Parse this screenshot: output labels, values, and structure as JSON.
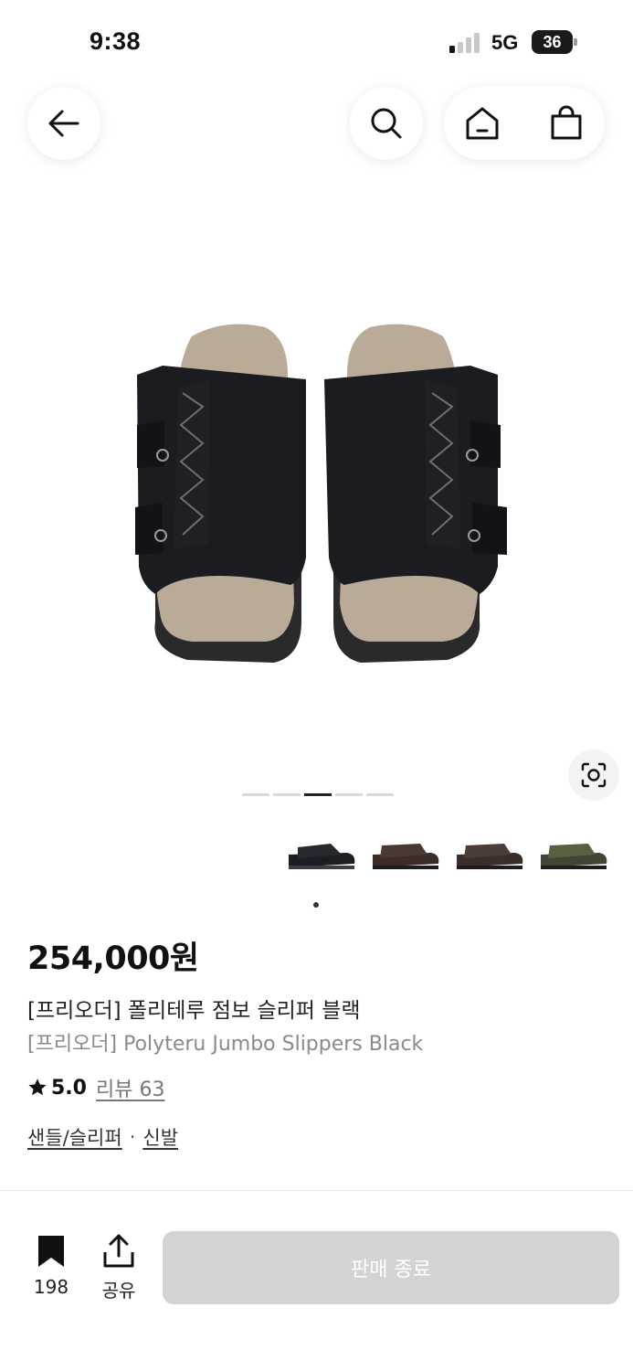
{
  "status_bar": {
    "time": "9:38",
    "network": "5G",
    "battery": "36"
  },
  "nav": {
    "back_icon": "arrow-left-icon",
    "search_icon": "search-icon",
    "home_icon": "home-icon",
    "cart_icon": "shopping-bag-icon"
  },
  "gallery": {
    "page_count": 5,
    "active_index": 2,
    "lens_icon": "visual-search-icon"
  },
  "thumbnails": {
    "colors": [
      "#1c1e22",
      "#3b2c28",
      "#3a2e2a",
      "#3e4636"
    ]
  },
  "product": {
    "price": "254,000원",
    "title_ko": "[프리오더] 폴리테루 점보 슬리퍼 블랙",
    "title_en": "[프리오더] Polyteru Jumbo Slippers Black",
    "rating": "5.0",
    "review_label": "리뷰 63",
    "categories": [
      "샌들/슬리퍼",
      "신발"
    ],
    "category_sep": "·"
  },
  "bottom_bar": {
    "bookmark_count": "198",
    "share_label": "공유",
    "cta_label": "판매 종료"
  },
  "colors": {
    "cta_disabled": "#d3d3d3",
    "pager_active": "#222222",
    "pager_inactive": "#d9d9d9"
  }
}
